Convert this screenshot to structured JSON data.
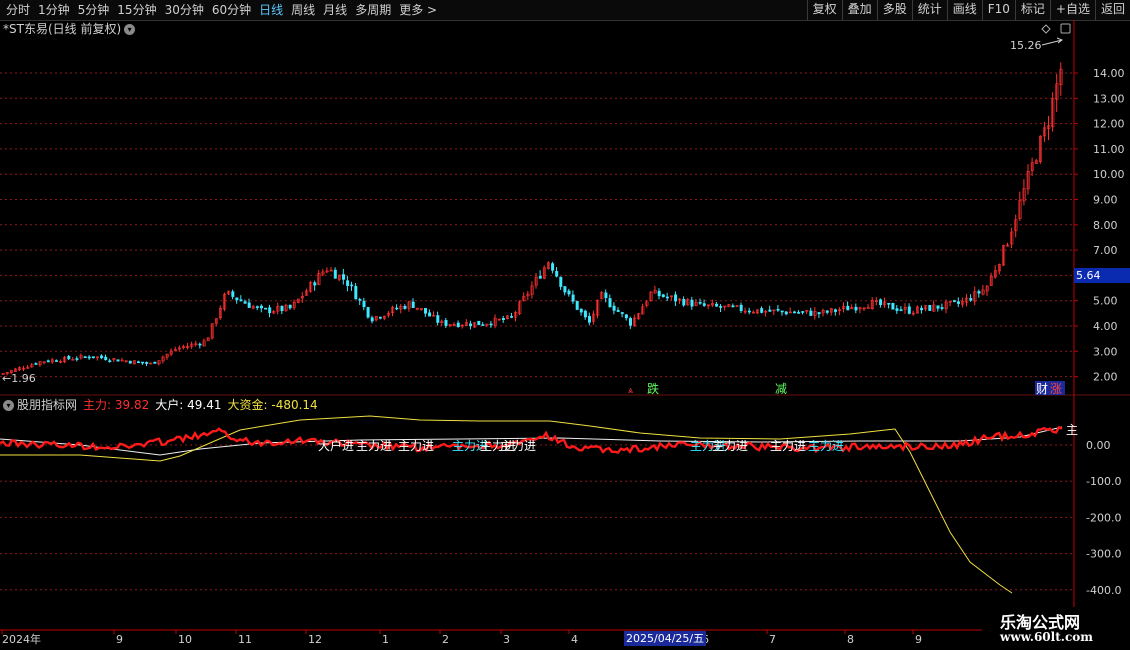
{
  "toolbar": {
    "periods": [
      "分时",
      "1分钟",
      "5分钟",
      "15分钟",
      "30分钟",
      "60分钟",
      "日线",
      "周线",
      "月线",
      "多周期",
      "更多 >"
    ],
    "active_period": "日线",
    "buttons": [
      "复权",
      "叠加",
      "多股",
      "统计",
      "画线",
      "F10",
      "标记",
      "+自选",
      "返回"
    ]
  },
  "main_chart": {
    "title": "*ST东易(日线 前复权)",
    "price_ticks": [
      "14.00",
      "13.00",
      "12.00",
      "11.00",
      "10.00",
      "9.00",
      "8.00",
      "7.00",
      "6.00",
      "5.00",
      "4.00",
      "3.00",
      "2.00"
    ],
    "high_label": "15.26",
    "low_label": "1.96",
    "current_price": "5.64",
    "markers": [
      "跌",
      "减",
      "财",
      "涨"
    ]
  },
  "indicator": {
    "name": "股朋指标网",
    "zhuli_label": "主力:",
    "zhuli_value": "39.82",
    "dahu_label": "大户:",
    "dahu_value": "49.41",
    "dazijin_label": "大资金:",
    "dazijin_value": "-480.14",
    "ticks": [
      "0.00",
      "-100.0",
      "-200.0",
      "-300.0",
      "-400.0"
    ],
    "signals": [
      "大户进",
      "主力进",
      "主力进",
      "主力进",
      "主力进",
      "主力进",
      "主力进",
      "主力进",
      "主力进",
      "主力进"
    ],
    "right_label": "主"
  },
  "time_axis": {
    "labels": [
      "2024年",
      "9",
      "10",
      "11",
      "12",
      "1",
      "2",
      "3",
      "4",
      "6",
      "7",
      "8",
      "9"
    ],
    "cursor_date": "2025/04/25/五"
  },
  "watermark": {
    "line1": "乐淘公式网",
    "line2": "www.60lt.com"
  },
  "colors": {
    "up": "#ff3030",
    "down": "#3ee8ff",
    "zhuli": "#ff2020",
    "dahu": "#ffffff",
    "dazijin": "#f0e040",
    "grid": "#8b1a1a",
    "axis": "#c00000"
  }
}
